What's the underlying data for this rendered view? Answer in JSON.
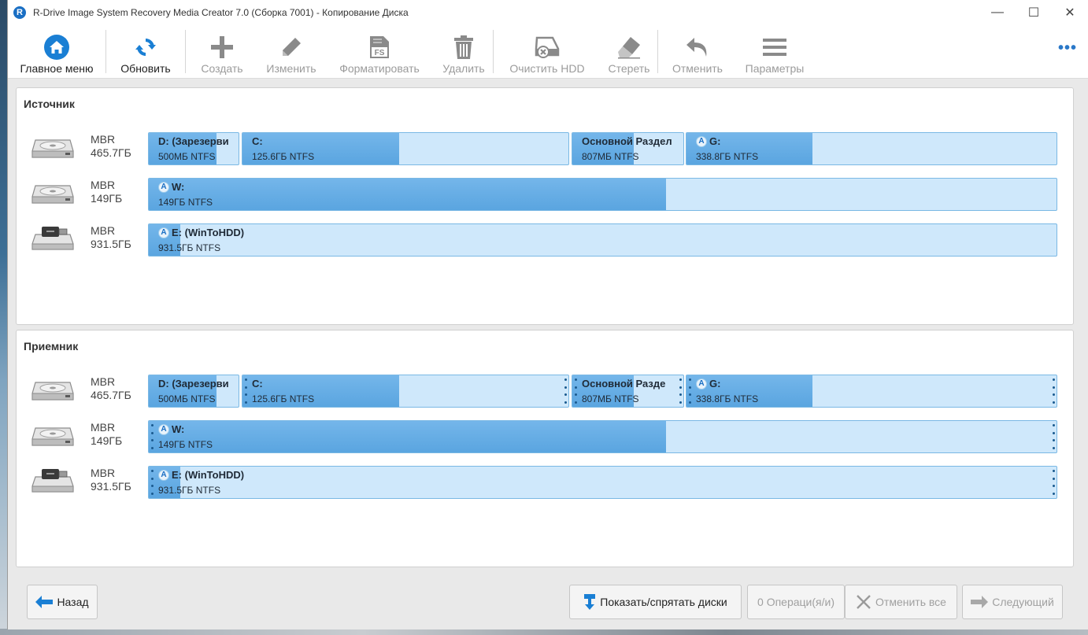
{
  "window": {
    "title": "R-Drive Image System Recovery Media Creator 7.0 (Сборка 7001) - Копирование Диска",
    "app_icon_letter": "R",
    "controls": {
      "minimize": "—",
      "maximize": "☐",
      "close": "✕"
    }
  },
  "toolbar": {
    "home": "Главное меню",
    "refresh": "Обновить",
    "create": "Создать",
    "edit": "Изменить",
    "format": "Форматировать",
    "format_icon_text": "FS",
    "delete": "Удалить",
    "wipe_hdd": "Очистить HDD",
    "erase": "Стереть",
    "undo": "Отменить",
    "settings": "Параметры",
    "more": "•••"
  },
  "colors": {
    "accent": "#2a78c8",
    "partition_used": "#5aa5e0",
    "partition_free": "#cfe8fb",
    "partition_border": "#7ab8e4"
  },
  "source": {
    "title": "Источник",
    "disks": [
      {
        "scheme": "MBR",
        "size": "465.7ГБ",
        "icon": "hdd-icon",
        "partitions": [
          {
            "name": "D: (Зарезерви",
            "info": "500МБ NTFS",
            "used": 0.75,
            "badge": ""
          },
          {
            "name": "C:",
            "info": "125.6ГБ NTFS",
            "used": 0.48,
            "badge": ""
          },
          {
            "name": "Основной Раздел",
            "info": "807МБ NTFS",
            "used": 0.55,
            "badge": ""
          },
          {
            "name": "G:",
            "info": "338.8ГБ NTFS",
            "used": 0.34,
            "badge": "A"
          }
        ]
      },
      {
        "scheme": "MBR",
        "size": "149ГБ",
        "icon": "hdd-icon",
        "partitions": [
          {
            "name": "W:",
            "info": "149ГБ NTFS",
            "used": 0.57,
            "badge": "A"
          }
        ]
      },
      {
        "scheme": "MBR",
        "size": "931.5ГБ",
        "icon": "usb-drive-icon",
        "partitions": [
          {
            "name": "E: (WinToHDD)",
            "info": "931.5ГБ NTFS",
            "used": 0.035,
            "badge": "A"
          }
        ]
      }
    ]
  },
  "target": {
    "title": "Приемник",
    "disks": [
      {
        "scheme": "MBR",
        "size": "465.7ГБ",
        "icon": "hdd-icon",
        "partitions": [
          {
            "name": "D: (Зарезерви",
            "info": "500МБ NTFS",
            "used": 0.75,
            "badge": ""
          },
          {
            "name": "C:",
            "info": "125.6ГБ NTFS",
            "used": 0.48,
            "badge": ""
          },
          {
            "name": "Основной Разде",
            "info": "807МБ NTFS",
            "used": 0.55,
            "badge": ""
          },
          {
            "name": "G:",
            "info": "338.8ГБ NTFS",
            "used": 0.34,
            "badge": "A"
          }
        ]
      },
      {
        "scheme": "MBR",
        "size": "149ГБ",
        "icon": "hdd-icon",
        "partitions": [
          {
            "name": "W:",
            "info": "149ГБ NTFS",
            "used": 0.57,
            "badge": "A"
          }
        ]
      },
      {
        "scheme": "MBR",
        "size": "931.5ГБ",
        "icon": "usb-drive-icon",
        "partitions": [
          {
            "name": "E: (WinToHDD)",
            "info": "931.5ГБ NTFS",
            "used": 0.035,
            "badge": "A"
          }
        ]
      }
    ]
  },
  "bottom": {
    "back": "Назад",
    "show_hide_disks": "Показать/спрятать диски",
    "operations": "0 Операци(я/и)",
    "cancel_all": "Отменить все",
    "next": "Следующий"
  }
}
